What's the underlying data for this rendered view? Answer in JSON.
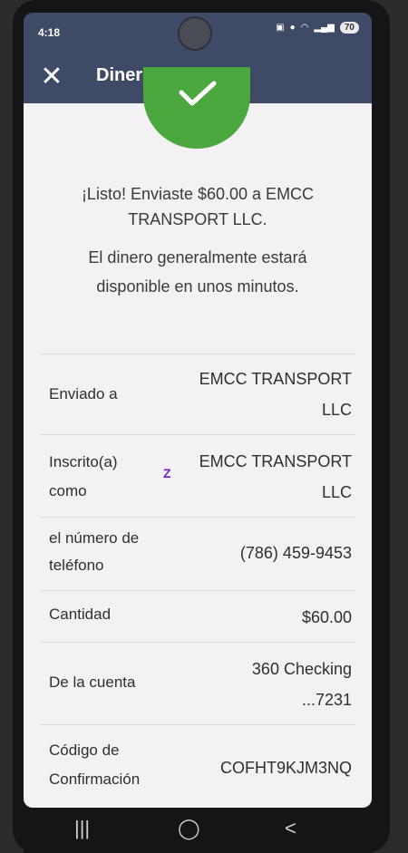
{
  "status": {
    "time": "4:18",
    "battery": "70"
  },
  "header": {
    "title": "Dinero enviado"
  },
  "confirmation": {
    "headline": "¡Listo! Enviaste $60.00 a EMCC TRANSPORT LLC.",
    "subtext": "El dinero generalmente estará disponible en unos minutos."
  },
  "details": [
    {
      "label": "Enviado a",
      "value": "EMCC TRANSPORT LLC"
    },
    {
      "label": "Inscrito(a) como",
      "value": "EMCC TRANSPORT LLC"
    },
    {
      "label": "el número de teléfono",
      "value": "(786) 459-9453"
    },
    {
      "label": "Cantidad",
      "value": "$60.00"
    },
    {
      "label": "De la cuenta",
      "value": "360 Checking ...7231"
    },
    {
      "label": "Código de Confirmación",
      "value": "COFHT9KJM3NQ"
    }
  ],
  "colors": {
    "header": "#3e4a66",
    "success": "#4ba83f",
    "zelle": "#6b1fd1",
    "background": "#f4f1f4"
  },
  "icons": {
    "close": "close-icon",
    "check": "check-icon",
    "zelle": "zelle-icon"
  }
}
